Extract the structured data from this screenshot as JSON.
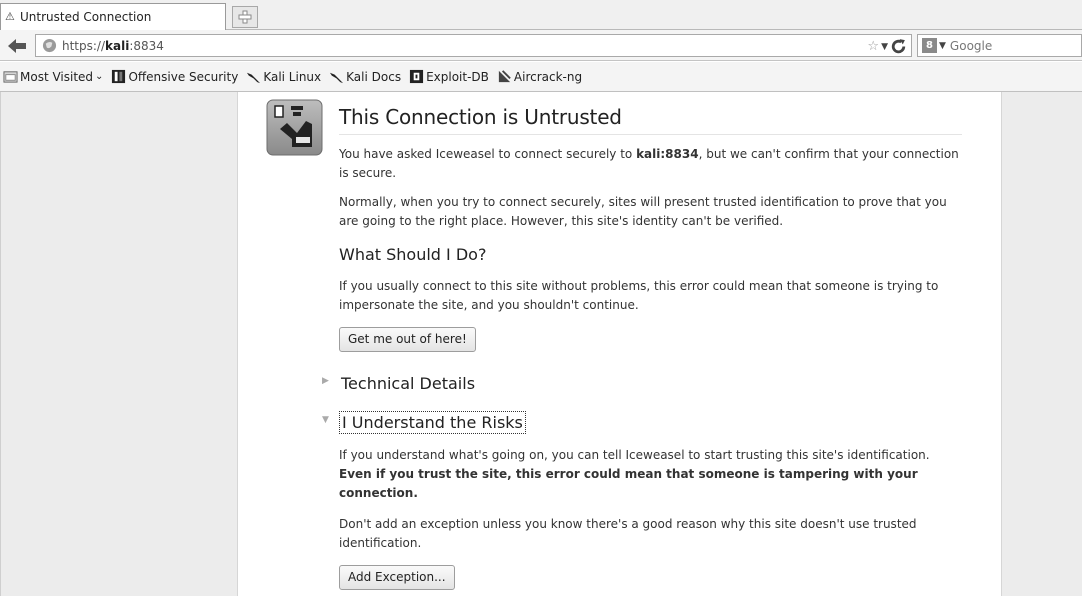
{
  "window": {
    "tab_title": "Untrusted Connection",
    "tab_icon": "warning-icon"
  },
  "navigation": {
    "url_prefix": "https://",
    "url_host": "kali",
    "url_suffix": ":8834",
    "search_placeholder": "Google",
    "search_engine_icon": "google-icon"
  },
  "bookmarks": [
    {
      "label": "Most Visited",
      "icon": "folder-icon",
      "dropdown": true
    },
    {
      "label": "Offensive Security",
      "icon": "offsec-icon"
    },
    {
      "label": "Kali Linux",
      "icon": "kali-dragon-icon"
    },
    {
      "label": "Kali Docs",
      "icon": "kali-dragon-icon"
    },
    {
      "label": "Exploit-DB",
      "icon": "exploitdb-icon"
    },
    {
      "label": "Aircrack-ng",
      "icon": "aircrack-icon"
    }
  ],
  "page": {
    "title": "This Connection is Untrusted",
    "intro_before": "You have asked Iceweasel to connect securely to ",
    "intro_host": "kali:8834",
    "intro_after": ", but we can't confirm that your connection is secure.",
    "normally": "Normally, when you try to connect securely, sites will present trusted identification to prove that you are going to the right place. However, this site's identity can't be verified.",
    "what_heading": "What Should I Do?",
    "what_text": "If you usually connect to this site without problems, this error could mean that someone is trying to impersonate the site, and you shouldn't continue.",
    "get_out_button": "Get me out of here!",
    "technical_details": "Technical Details",
    "understand_risks": "I Understand the Risks",
    "risks_text": "If you understand what's going on, you can tell Iceweasel to start trusting this site's identification. ",
    "risks_bold": "Even if you trust the site, this error could mean that someone is tampering with your connection.",
    "dont_add": "Don't add an exception unless you know there's a good reason why this site doesn't use trusted identification.",
    "add_exception_button": "Add Exception..."
  },
  "colors": {
    "chrome": "#f4f4f4",
    "page_bg": "#ececec",
    "panel_bg": "#ffffff"
  }
}
